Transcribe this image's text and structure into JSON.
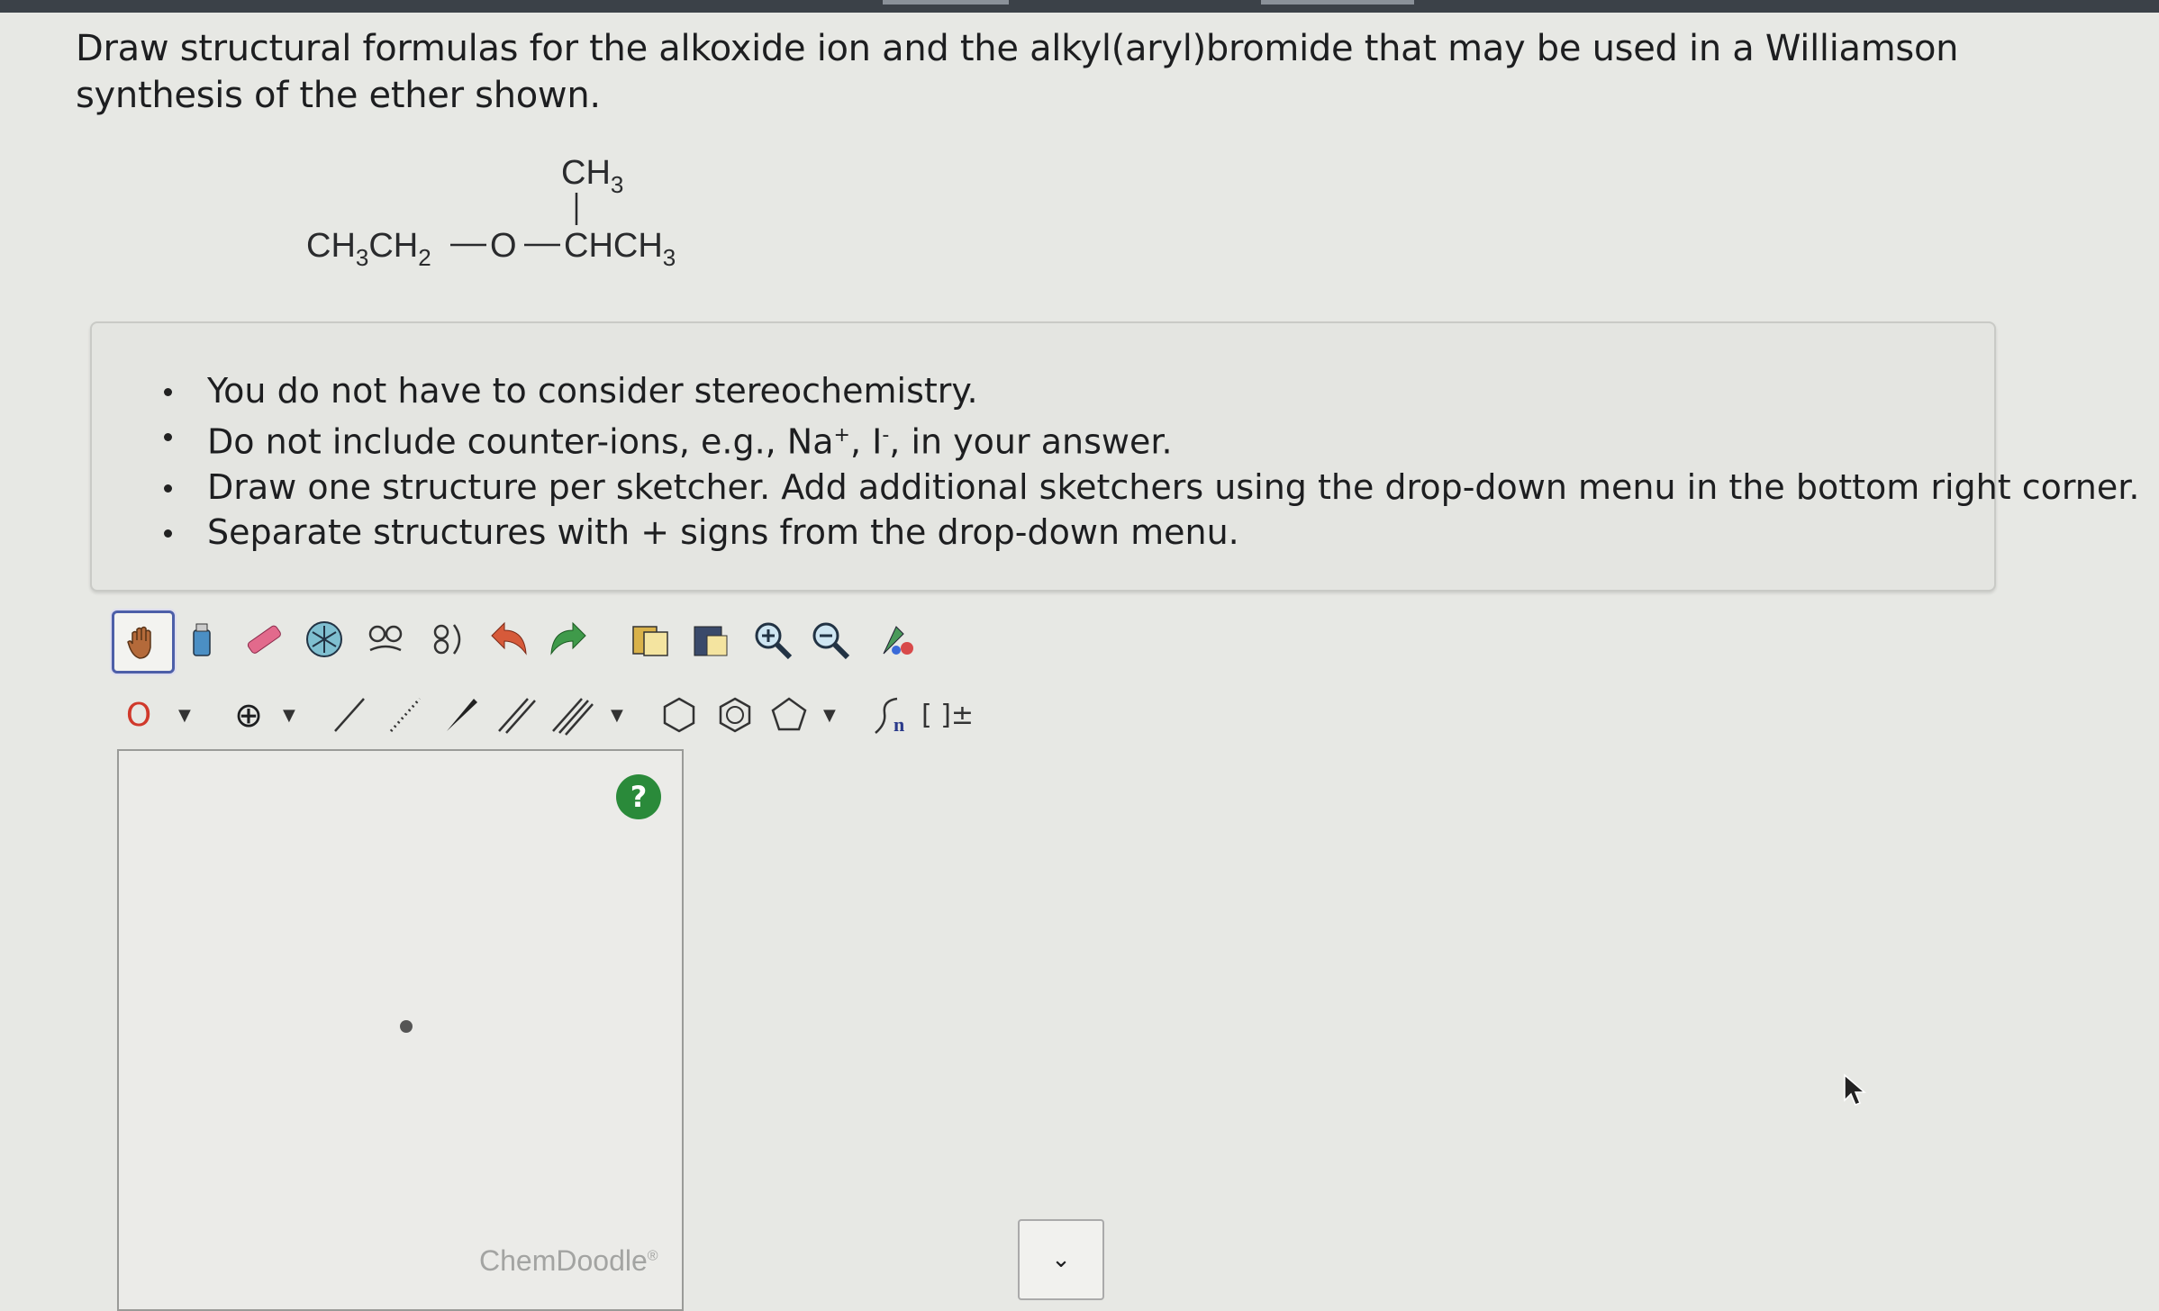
{
  "question": {
    "text": "Draw structural formulas for the alkoxide ion and the alkyl(aryl)bromide that may be used in a Williamson synthesis of the ether shown."
  },
  "structure": {
    "top_group": "CH",
    "top_sub": "3",
    "left_group": "CH",
    "left_sub1": "3",
    "left_mid": "CH",
    "left_sub2": "2",
    "oxygen": "O",
    "right_group": "CHCH",
    "right_sub": "3"
  },
  "instructions": {
    "items": [
      "You do not have to consider stereochemistry.",
      "Draw one structure per sketcher. Add additional sketchers using the drop-down menu in the bottom right corner.",
      "Separate structures with + signs from the drop-down menu."
    ],
    "counter_ion_prefix": "Do not include counter-ions, e.g., Na",
    "counter_ion_plus": "+",
    "counter_ion_mid": ", I",
    "counter_ion_minus": "-",
    "counter_ion_suffix": ", in your answer."
  },
  "toolbar1": {
    "icons": [
      "hand-icon",
      "clear-icon",
      "eraser-icon",
      "ring-template-icon",
      "copy-molecule-icon",
      "flip-icon",
      "undo-icon",
      "redo-icon",
      "copy-icon",
      "paste-icon",
      "zoom-in-icon",
      "zoom-out-icon",
      "clean-icon"
    ]
  },
  "toolbar2": {
    "atom_label": "O",
    "charge_label": "⊕",
    "sgroup_label": "n",
    "bracket_label": "[ ]±"
  },
  "sketcher": {
    "help_label": "?",
    "brand": "ChemDoodle",
    "brand_mark": "®"
  },
  "dropdown": {
    "label": "⌄"
  },
  "colors": {
    "accent": "#4d5fa8",
    "help": "#2a8a3a",
    "atom_o": "#d0392b"
  }
}
